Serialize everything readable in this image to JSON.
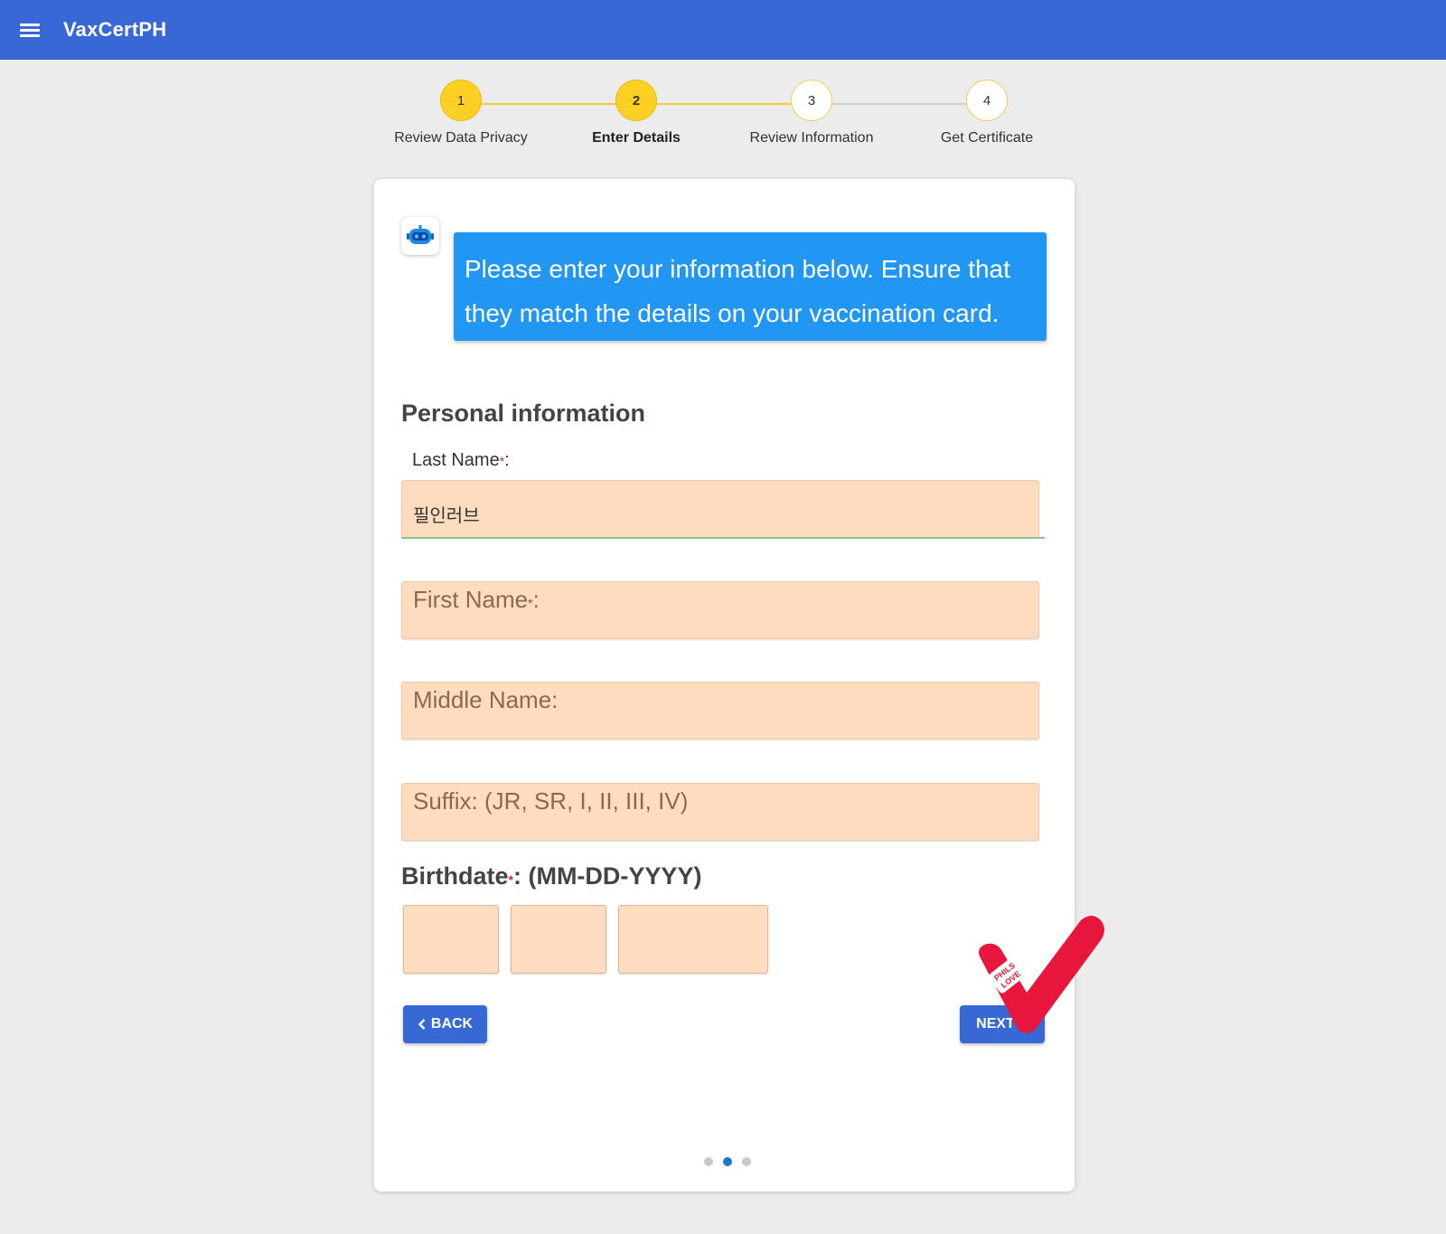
{
  "app": {
    "title": "VaxCertPH"
  },
  "stepper": {
    "steps": [
      {
        "number": "1",
        "label": "Review Data Privacy",
        "state": "done"
      },
      {
        "number": "2",
        "label": "Enter Details",
        "state": "active"
      },
      {
        "number": "3",
        "label": "Review Information",
        "state": "todo"
      },
      {
        "number": "4",
        "label": "Get Certificate",
        "state": "todo"
      }
    ]
  },
  "chat": {
    "message": "Please enter your information below. Ensure that they match the details on your vaccination card."
  },
  "form": {
    "section_title": "Personal information",
    "last_name": {
      "label": "Last Name",
      "required_mark": "*",
      "suffix": ":",
      "value": "필인러브"
    },
    "first_name": {
      "label": "First Name",
      "required_mark": "*",
      "suffix": ":"
    },
    "middle_name": {
      "label": "Middle Name:"
    },
    "name_suffix": {
      "label": "Suffix: (JR, SR, I, II, III, IV)"
    },
    "birthdate": {
      "label": "Birthdate",
      "required_mark": "*",
      "suffix": ": (MM-DD-YYYY)"
    }
  },
  "buttons": {
    "back": "BACK",
    "next": "NEXT"
  },
  "pagination": {
    "count": 3,
    "active_index": 1
  },
  "stamp": {
    "text_line1": "PHILS",
    "text_line2": "LOVE"
  },
  "colors": {
    "appbar": "#3867d6",
    "step_yellow": "#fdd023",
    "bubble": "#2196f3",
    "field_fill": "#fedcbf",
    "button": "#3867d6",
    "check_red": "#e8163c"
  }
}
